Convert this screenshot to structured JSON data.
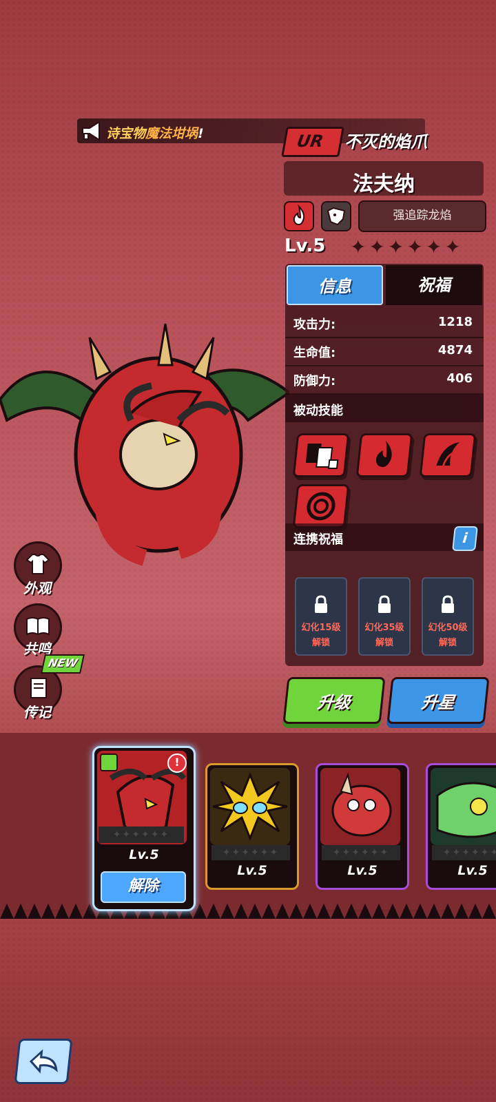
{
  "announcement": {
    "part1": "诗宝物",
    "part2": "魔法坩埚",
    "part3": "!"
  },
  "weapon": {
    "rarity": "UR",
    "name": "不灭的焰爪"
  },
  "hero": {
    "name": "法夫纳",
    "skill_tag": "强追踪龙焰",
    "level": "Lv.5",
    "stars": "✦✦✦✦✦✦"
  },
  "tabs": [
    {
      "label": "信息"
    },
    {
      "label": "祝福"
    }
  ],
  "stats": [
    {
      "label": "攻击力:",
      "value": "1218"
    },
    {
      "label": "生命值:",
      "value": "4874"
    },
    {
      "label": "防御力:",
      "value": "406"
    }
  ],
  "sections": {
    "passive": "被动技能",
    "bond": "连携祝福",
    "info": "i"
  },
  "bond_slots": [
    {
      "condition": "幻化15级",
      "state": "解锁"
    },
    {
      "condition": "幻化35级",
      "state": "解锁"
    },
    {
      "condition": "幻化50级",
      "state": "解锁"
    }
  ],
  "buttons": {
    "upgrade": "升级",
    "star_up": "升星",
    "remove": "解除"
  },
  "side_menu": [
    {
      "label": "外观"
    },
    {
      "label": "共鸣"
    },
    {
      "label": "传记"
    }
  ],
  "new_badge": "NEW",
  "roster": [
    {
      "level": "Lv.5"
    },
    {
      "level": "Lv.5"
    },
    {
      "level": "Lv.5"
    },
    {
      "level": "Lv.5"
    }
  ],
  "roster_stars": "✦✦✦✦✦✦",
  "colors": {
    "accent_blue": "#3d95e6",
    "accent_green": "#6fd53a",
    "rarity_red": "#d62f33"
  }
}
